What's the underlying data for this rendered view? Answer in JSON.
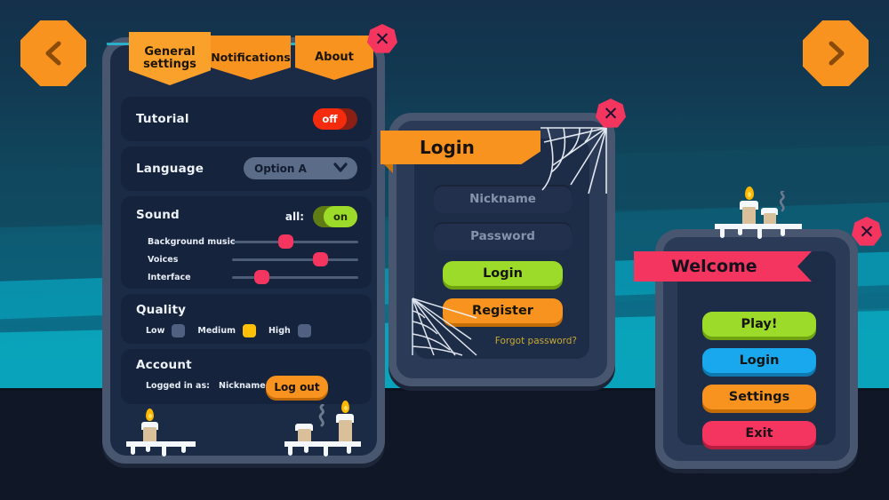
{
  "theme": {
    "orange": "#f7931e",
    "pink": "#f4355f",
    "green": "#9ddb2a",
    "blue": "#19a7ed",
    "yellow": "#ffc107",
    "panel_dark": "#1b2a45",
    "panel_frame": "#48576f",
    "cyan_glow": "#5fe6ff",
    "gold_glow": "#e8c31a"
  },
  "nav": {
    "prev_icon": "chevron-left-icon",
    "next_icon": "chevron-right-icon"
  },
  "settings": {
    "close_label": "✕",
    "tabs": [
      {
        "label": "General settings",
        "active": true
      },
      {
        "label": "Notifications",
        "active": false
      },
      {
        "label": "About",
        "active": false
      }
    ],
    "tutorial": {
      "label": "Tutorial",
      "toggle_value": "off",
      "toggle_state": "off"
    },
    "language": {
      "label": "Language",
      "selected": "Option A",
      "chevron_icon": "chevron-down-icon"
    },
    "sound": {
      "label": "Sound",
      "all_label": "all:",
      "toggle_value": "on",
      "toggle_state": "on",
      "sliders": [
        {
          "label": "Background music",
          "value": 42
        },
        {
          "label": "Voices",
          "value": 70
        },
        {
          "label": "Interface",
          "value": 23
        }
      ]
    },
    "quality": {
      "label": "Quality",
      "options": [
        {
          "label": "Low",
          "selected": false
        },
        {
          "label": "Medium",
          "selected": true
        },
        {
          "label": "High",
          "selected": false
        }
      ]
    },
    "account": {
      "label": "Account",
      "logged_in_label": "Logged in as:",
      "username": "Nickname",
      "logout_label": "Log out"
    }
  },
  "login": {
    "title": "Login",
    "close_label": "✕",
    "nickname_placeholder": "Nickname",
    "nickname_value": "",
    "password_placeholder": "Password",
    "password_value": "",
    "login_label": "Login",
    "register_label": "Register",
    "forgot_label": "Forgot password?"
  },
  "welcome": {
    "title": "Welcome",
    "close_label": "✕",
    "buttons": [
      {
        "label": "Play!",
        "color": "#9ddb2a"
      },
      {
        "label": "Login",
        "color": "#19a7ed"
      },
      {
        "label": "Settings",
        "color": "#f7931e"
      },
      {
        "label": "Exit",
        "color": "#f4355f"
      }
    ]
  }
}
